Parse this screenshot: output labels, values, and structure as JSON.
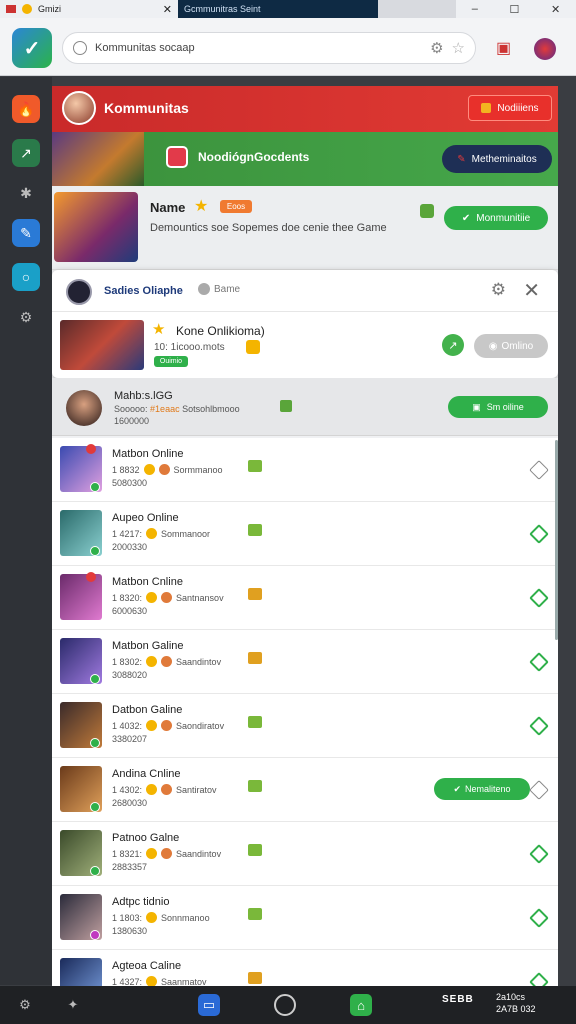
{
  "tabs": [
    {
      "label": "Gmizi"
    },
    {
      "label": "Gcmmunitras Seint"
    }
  ],
  "window_controls": [
    "–",
    "☐",
    "✕"
  ],
  "search": {
    "value": "Kommunitas socaap"
  },
  "header": {
    "title": "Kommunitas",
    "button_label": "Nodiiiens"
  },
  "banner": {
    "title": "NoodiógnGocdents",
    "button_label": "Metheminaitos"
  },
  "featured": {
    "name": "Name",
    "badge": "Eoos",
    "description": "Demountics soe Sopemes doe cenie thee Game",
    "button_label": "Monmunitiie"
  },
  "popup": {
    "title": "Sadies Oliaphe",
    "badge": "Bame",
    "game_name": "Kone Onlikioma)",
    "meta": "10: 1icooo.mots",
    "chip": "Ouimio",
    "button_label": "Omlino"
  },
  "current": {
    "name": "Mahb:s.lGG",
    "meta_prefix": "Sooooo:",
    "meta_highlight": "#1eaac",
    "meta_suffix": "Sotsohlbmooo",
    "number": "1600000",
    "button_label": "Sm oiline"
  },
  "rows": [
    {
      "name": "Matbon Online",
      "meta": "1 8832",
      "status": "Sormmanoo",
      "sub": "5080300"
    },
    {
      "name": "Aupeo Online",
      "meta": "1 4217:",
      "status": "Sommanoor",
      "sub": "2000330"
    },
    {
      "name": "Matbon Cnline",
      "meta": "1 8320:",
      "status": "Santnansov",
      "sub": "6000630"
    },
    {
      "name": "Matbon Galine",
      "meta": "1 8302:",
      "status": "Saandintov",
      "sub": "3088020"
    },
    {
      "name": "Datbon Galine",
      "meta": "1 4032:",
      "status": "Saondiratov",
      "sub": "3380207"
    },
    {
      "name": "Andina Cnline",
      "meta": "1 4302:",
      "status": "Santiratov",
      "sub": "2680030",
      "button_label": "Nemaliteno"
    },
    {
      "name": "Patnoo Galne",
      "meta": "1 8321:",
      "status": "Saandintov",
      "sub": "2883357"
    },
    {
      "name": "Adtpc tidnio",
      "meta": "1 1803:",
      "status": "Sonnmanoo",
      "sub": "1380630"
    },
    {
      "name": "Agteoa Caline",
      "meta": "1 4327:",
      "status": "Saanmatov",
      "sub": ""
    }
  ],
  "taskbar": {
    "tray": "SEBB",
    "clock_time": "2a10cs",
    "clock_date": "2A7B 032"
  }
}
